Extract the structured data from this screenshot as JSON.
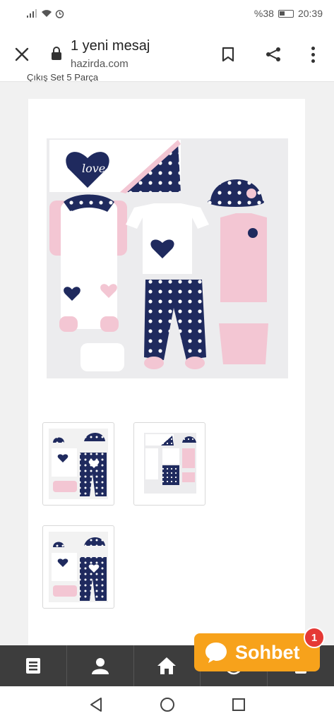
{
  "status_bar": {
    "battery": "%38",
    "time": "20:39"
  },
  "url_bar": {
    "title": "1 yeni mesaj",
    "domain": "hazirda.com"
  },
  "page": {
    "clipped_title": "Çıkış Set 5 Parça"
  },
  "main_image": {
    "caption_text": "love"
  },
  "thumbnails": [
    {
      "label": "product-thumb-1"
    },
    {
      "label": "product-thumb-2"
    },
    {
      "label": "product-thumb-3"
    }
  ],
  "bottom_nav": {
    "items": [
      {
        "icon": "list-icon"
      },
      {
        "icon": "user-icon"
      },
      {
        "icon": "home-icon"
      },
      {
        "icon": "whatsapp-icon"
      },
      {
        "icon": "cart-icon"
      }
    ]
  },
  "chat": {
    "label": "Sohbet",
    "badge": "1"
  },
  "colors": {
    "orange": "#f7a21b",
    "navy": "#1f2a5e",
    "pink": "#f3c6d3",
    "badge_red": "#e53935"
  }
}
